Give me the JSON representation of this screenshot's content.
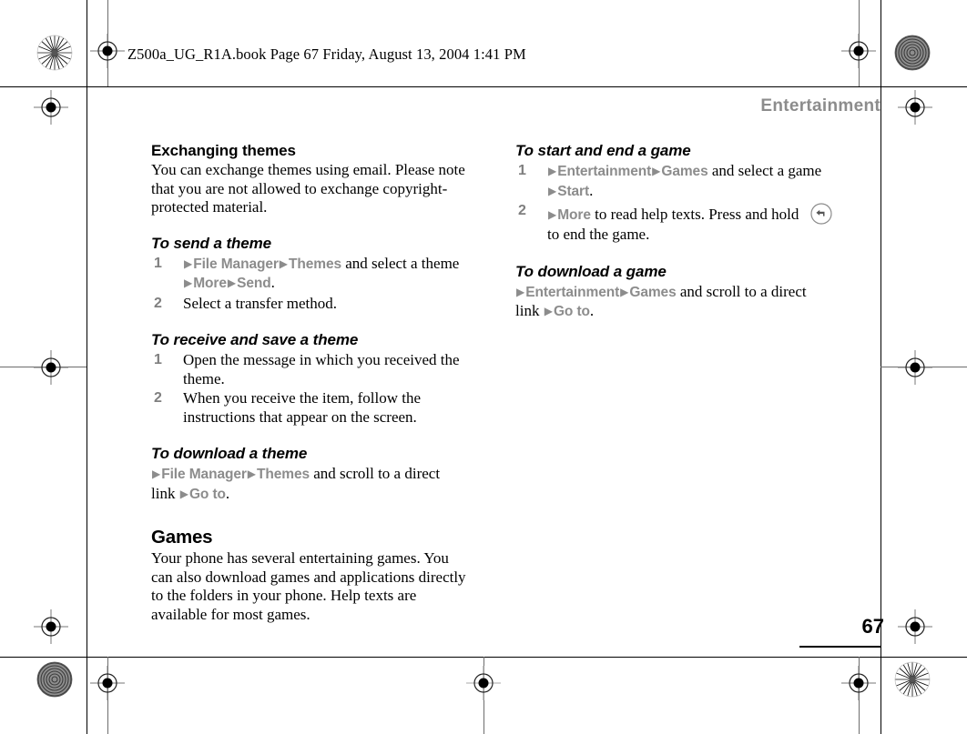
{
  "page": {
    "slugline": "Z500a_UG_R1A.book  Page 67  Friday, August 13, 2004  1:41 PM",
    "running_head": "Entertainment",
    "folio": "67",
    "triangle_glyph": "▶"
  },
  "colors": {
    "menu_grey": "#8c8c8c",
    "step_number_grey": "#7f7f7f",
    "body_black": "#000000",
    "page_background": "#ffffff"
  },
  "left_column": {
    "section_heading": "Exchanging themes",
    "section_body": "You can exchange themes using email. Please note that you are not allowed to exchange copyright-protected material.",
    "proc_send": {
      "title": "To send a theme",
      "steps": [
        {
          "number": "1",
          "parts": [
            {
              "type": "tri"
            },
            {
              "type": "menu",
              "text": "File Manager"
            },
            {
              "type": "tri"
            },
            {
              "type": "menu",
              "text": "Themes"
            },
            {
              "type": "text",
              "text": " and select a theme "
            },
            {
              "type": "tri"
            },
            {
              "type": "menu",
              "text": "More"
            },
            {
              "type": "tri"
            },
            {
              "type": "menu",
              "text": "Send"
            },
            {
              "type": "text",
              "text": "."
            }
          ]
        },
        {
          "number": "2",
          "parts": [
            {
              "type": "text",
              "text": "Select a transfer method."
            }
          ]
        }
      ]
    },
    "proc_receive": {
      "title": "To receive and save a theme",
      "steps": [
        {
          "number": "1",
          "parts": [
            {
              "type": "text",
              "text": "Open the message in which you received the theme."
            }
          ]
        },
        {
          "number": "2",
          "parts": [
            {
              "type": "text",
              "text": "When you receive the item, follow the instructions that appear on the screen."
            }
          ]
        }
      ]
    },
    "proc_download_theme": {
      "title": "To download a theme",
      "navline": [
        {
          "type": "tri"
        },
        {
          "type": "menu",
          "text": "File Manager"
        },
        {
          "type": "tri"
        },
        {
          "type": "menu",
          "text": "Themes"
        },
        {
          "type": "text",
          "text": " and scroll to a direct link "
        },
        {
          "type": "tri"
        },
        {
          "type": "menu",
          "text": "Go to"
        },
        {
          "type": "text",
          "text": "."
        }
      ]
    },
    "games_heading": "Games",
    "games_body": "Your phone has several entertaining games. You can also download games and applications directly to the folders in your phone. Help texts are available for most games."
  },
  "right_column": {
    "proc_start_end": {
      "title": "To start and end a game",
      "steps": [
        {
          "number": "1",
          "parts": [
            {
              "type": "tri"
            },
            {
              "type": "menu",
              "text": "Entertainment"
            },
            {
              "type": "tri"
            },
            {
              "type": "menu",
              "text": "Games"
            },
            {
              "type": "text",
              "text": " and select a game "
            },
            {
              "type": "tri"
            },
            {
              "type": "menu",
              "text": "Start"
            },
            {
              "type": "text",
              "text": "."
            }
          ]
        },
        {
          "number": "2",
          "parts": [
            {
              "type": "tri"
            },
            {
              "type": "menu",
              "text": "More"
            },
            {
              "type": "text",
              "text": " to read help texts. Press and hold "
            },
            {
              "type": "icon",
              "name": "back-key-icon"
            },
            {
              "type": "text",
              "text": " to end the game."
            }
          ]
        }
      ]
    },
    "proc_download_game": {
      "title": "To download a game",
      "navline": [
        {
          "type": "tri"
        },
        {
          "type": "menu",
          "text": "Entertainment"
        },
        {
          "type": "tri"
        },
        {
          "type": "menu",
          "text": "Games"
        },
        {
          "type": "text",
          "text": " and scroll to a direct link "
        },
        {
          "type": "tri"
        },
        {
          "type": "menu",
          "text": "Go to"
        },
        {
          "type": "text",
          "text": "."
        }
      ]
    }
  }
}
